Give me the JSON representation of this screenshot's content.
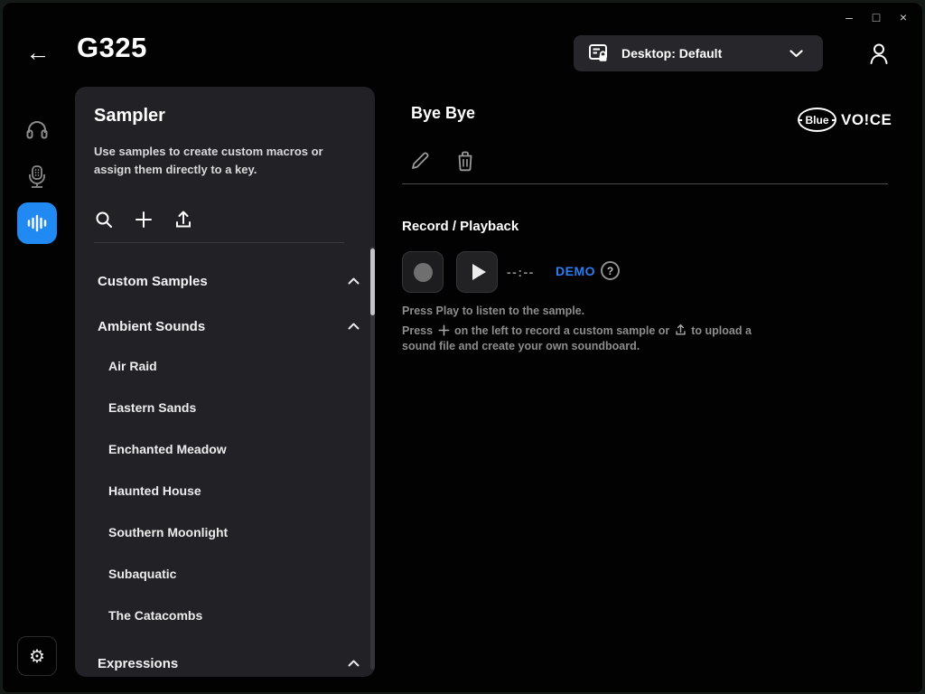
{
  "window": {
    "minimize": "–",
    "maximize": "□",
    "close": "×"
  },
  "header": {
    "back_arrow": "←",
    "title": "G325",
    "profile_dropdown": {
      "label": "Desktop: Default"
    }
  },
  "sidebar": {
    "settings_glyph": "⚙"
  },
  "sampler_panel": {
    "title": "Sampler",
    "description": "Use samples to create custom macros or assign them directly to a key.",
    "groups": [
      {
        "label": "Custom Samples"
      },
      {
        "label": "Ambient Sounds",
        "items": [
          "Air Raid",
          "Eastern Sands",
          "Enchanted Meadow",
          "Haunted House",
          "Southern Moonlight",
          "Subaquatic",
          "The Catacombs"
        ]
      },
      {
        "label": "Expressions"
      }
    ]
  },
  "content": {
    "sample_title": "Bye Bye",
    "brand": {
      "oval_text": "Blue",
      "wordmark": "VO!CE"
    },
    "section_title": "Record / Playback",
    "time_display": "--:--",
    "demo_badge": "DEMO",
    "help_glyph": "?",
    "hint_play": "Press Play to listen to the sample.",
    "hint_record_prefix": "Press",
    "hint_record_mid": "on the left to record a custom sample or",
    "hint_record_suffix": "to upload a sound file and create your own soundboard."
  },
  "colors": {
    "accent_blue": "#2089f2",
    "demo_blue": "#2c7ef2",
    "panel_bg": "#222226"
  }
}
